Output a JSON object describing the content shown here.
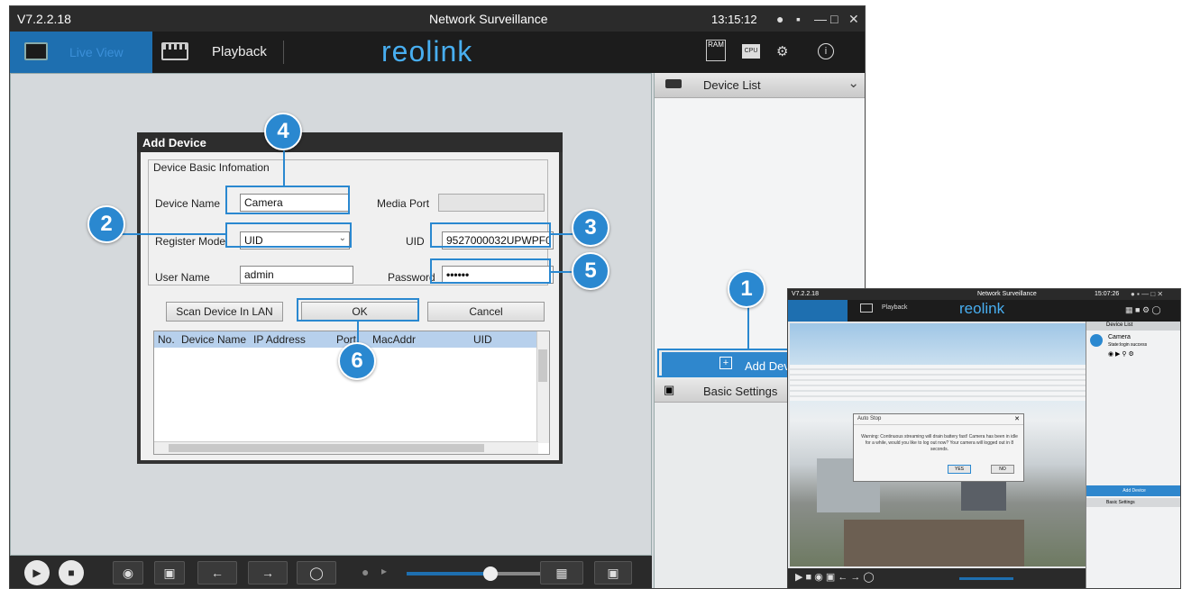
{
  "app": {
    "version": "V7.2.2.18",
    "title": "Network Surveillance",
    "clock": "13:15:12",
    "logo": "reolink"
  },
  "icons": {
    "globe": "globe-icon",
    "minimize": "minimize-icon",
    "maximize": "maximize-icon",
    "close": "close-icon",
    "ram": "RAM",
    "cpu": "CPU",
    "settings": "gear-icon",
    "info": "info-icon"
  },
  "nav": {
    "live_view": "Live View",
    "playback": "Playback"
  },
  "right_panel": {
    "device_list": "Device List",
    "add_device": "Add Devic",
    "basic_settings": "Basic Settings"
  },
  "dialog": {
    "title": "Add Device",
    "group_label": "Device Basic Infomation",
    "device_name_label": "Device Name",
    "device_name_value": "Camera",
    "media_port_label": "Media Port",
    "media_port_value": "",
    "register_mode_label": "Register Mode",
    "register_mode_value": "UID",
    "uid_label": "UID",
    "uid_value": "9527000032UPWPF0",
    "user_name_label": "User Name",
    "user_name_value": "admin",
    "password_label": "Password",
    "password_value": "••••••",
    "scan_button": "Scan Device In LAN",
    "ok_button": "OK",
    "cancel_button": "Cancel",
    "table_headers": [
      "No.",
      "Device Name",
      "IP Address",
      "Port",
      "MacAddr",
      "UID"
    ]
  },
  "callouts": [
    "1",
    "2",
    "3",
    "4",
    "5",
    "6"
  ],
  "volume_level": 0.62,
  "inset": {
    "version": "V7.2.2.18",
    "title": "Network Surveillance",
    "clock": "15:07:26",
    "playback": "Playback",
    "logo": "reolink",
    "device_list": "Device List",
    "camera_name": "Camera",
    "camera_status": "State:login success",
    "add_device": "Add Device",
    "basic_settings": "Basic Settings",
    "dialog_title": "Auto Stop",
    "dialog_text": "Warning: Continuous streaming will drain battery fast! Camera has been in idle for a while, would you like to log out now? Your camera will logged out in 8 seconds.",
    "yes": "YES",
    "no": "NO"
  },
  "colors": {
    "accent": "#2a88d0",
    "titlebar": "#2b2b2b",
    "live_tab": "#1e6fb0",
    "logo": "#48aef0"
  }
}
